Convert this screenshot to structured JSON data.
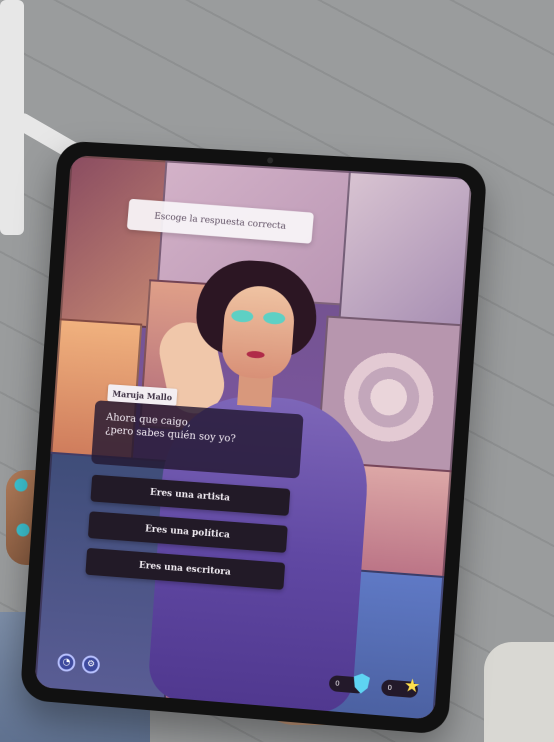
{
  "question": {
    "text": "Escoge la respuesta correcta"
  },
  "dialogue": {
    "speaker": "Maruja Mallo",
    "line1": "Ahora que caigo,",
    "line2": "¿pero sabes quién soy yo?"
  },
  "answers": [
    {
      "label": "Eres una artista"
    },
    {
      "label": "Eres una política"
    },
    {
      "label": "Eres una escritora"
    }
  ],
  "bottom_buttons": [
    {
      "icon": "profile-icon"
    },
    {
      "icon": "settings-icon"
    }
  ],
  "stats": [
    {
      "value": "0",
      "icon": "shield-icon"
    },
    {
      "value": "0",
      "icon": "star-icon"
    }
  ]
}
